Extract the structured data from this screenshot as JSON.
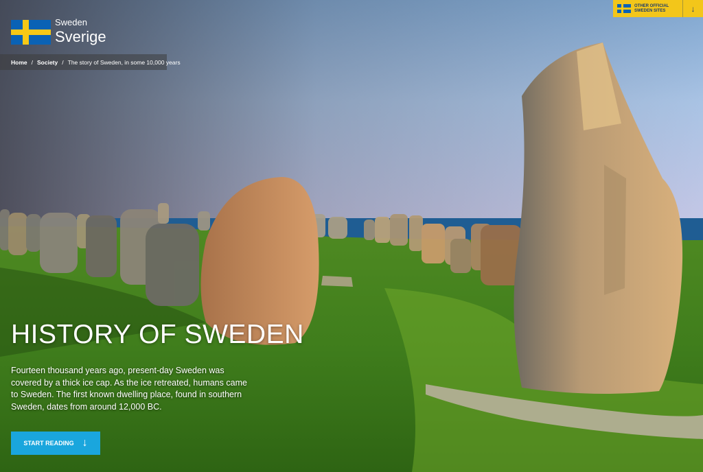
{
  "logo": {
    "line1": "Sweden",
    "line2": "Sverige"
  },
  "breadcrumb": {
    "items": [
      "Home",
      "Society",
      "The story of Sweden, in some 10,000 years"
    ],
    "separator": "/"
  },
  "official_sites": {
    "label": "OTHER OFFICIAL SWEDEN SITES",
    "arrow": "↓"
  },
  "hero": {
    "title": "HISTORY OF SWEDEN",
    "intro": "Fourteen thousand years ago, present-day Sweden was covered by a thick ice cap. As the ice retreated, humans came to Sweden. The first known dwelling place, found in southern Sweden, dates from around 12,000 BC.",
    "cta_label": "START READING",
    "cta_arrow": "↓"
  },
  "colors": {
    "flag_blue": "#0a62b5",
    "flag_yellow": "#f7c816",
    "accent_yellow": "#f3c61a",
    "cta_blue": "#1aa6dd"
  }
}
